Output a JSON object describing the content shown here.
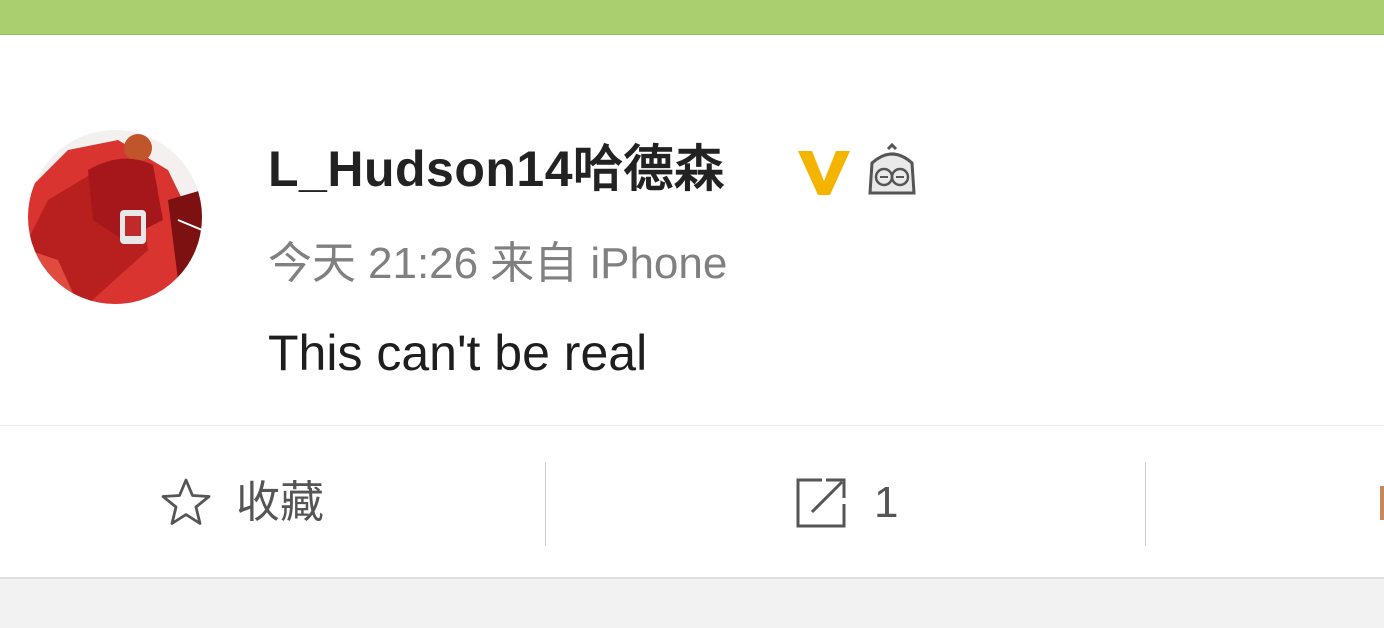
{
  "post": {
    "username": "L_Hudson14哈德森",
    "meta": {
      "date": "今天",
      "time": "21:26",
      "source": "来自 iPhone"
    },
    "text": "This can't be real"
  },
  "actions": {
    "favorite_label": "收藏",
    "repost_count": "1"
  },
  "icons": {
    "verified": "verified-v-icon",
    "badge": "member-badge-icon",
    "favorite": "star-outline-icon",
    "repost": "share-square-arrow-icon"
  },
  "colors": {
    "top_bar": "#a9cf6f",
    "verified_v": "#f5b400",
    "username": "#222222",
    "meta_text": "#808080"
  }
}
